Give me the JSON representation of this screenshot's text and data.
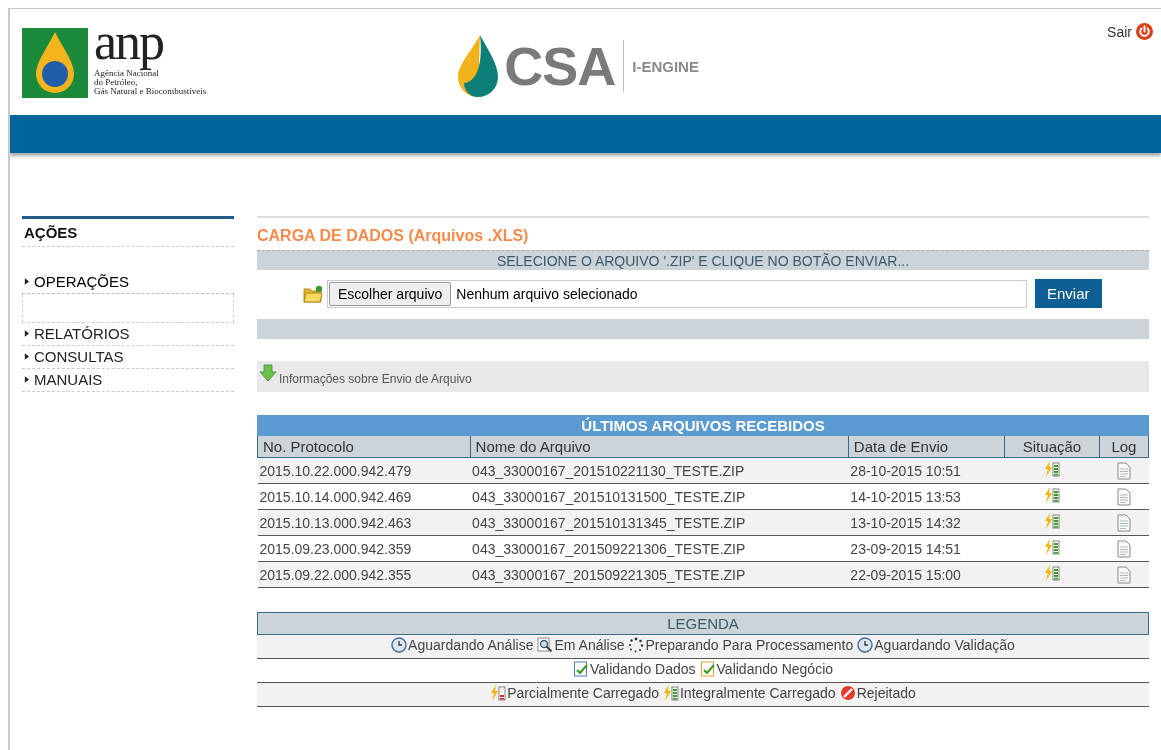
{
  "header": {
    "anp_logo": "anp",
    "anp_subtitle": [
      "Agência Nacional",
      "do Petróleo,",
      "Gás Natural e Biocombustíveis"
    ],
    "csa_logo": "CSA",
    "engine": "I-ENGINE",
    "logout": "Sair"
  },
  "sidebar": {
    "title": "AÇÕES",
    "items": [
      {
        "label": "OPERAÇÕES",
        "expanded": true
      },
      {
        "label": "RELATÓRIOS",
        "expanded": false
      },
      {
        "label": "CONSULTAS",
        "expanded": false
      },
      {
        "label": "MANUAIS",
        "expanded": false
      }
    ]
  },
  "upload": {
    "title": "CARGA DE DADOS (Arquivos .XLS)",
    "instruction": "SELECIONE O ARQUIVO '.ZIP' E CLIQUE NO BOTÃO ENVIAR...",
    "choose_button": "Escolher arquivo",
    "file_status": "Nenhum arquivo selecionado",
    "send_button": "Enviar",
    "info_link": "Informações sobre Envio de Arquivo"
  },
  "table": {
    "title": "ÚLTIMOS ARQUIVOS RECEBIDOS",
    "columns": [
      "No. Protocolo",
      "Nome do Arquivo",
      "Data de Envio",
      "Situação",
      "Log"
    ],
    "rows": [
      {
        "protocol": "2015.10.22.000.942.479",
        "file": "043_33000167_201510221130_TESTE.ZIP",
        "date": "28-10-2015 10:51",
        "kind": "integral"
      },
      {
        "protocol": "2015.10.14.000.942.469",
        "file": "043_33000167_201510131500_TESTE.ZIP",
        "date": "14-10-2015 13:53",
        "kind": "integral"
      },
      {
        "protocol": "2015.10.13.000.942.463",
        "file": "043_33000167_201510131345_TESTE.ZIP",
        "date": "13-10-2015 14:32",
        "kind": "integral"
      },
      {
        "protocol": "2015.09.23.000.942.359",
        "file": "043_33000167_201509221306_TESTE.ZIP",
        "date": "23-09-2015 14:51",
        "kind": "integral"
      },
      {
        "protocol": "2015.09.22.000.942.355",
        "file": "043_33000167_201509221305_TESTE.ZIP",
        "date": "22-09-2015 15:00",
        "kind": "integral"
      }
    ]
  },
  "legend": {
    "title": "LEGENDA",
    "lines": [
      {
        "entries": [
          {
            "kind": "clock",
            "label": "Aguardando Análise"
          },
          {
            "kind": "magnifier",
            "label": "Em Análise"
          },
          {
            "kind": "spinner",
            "label": "Preparando Para Processamento"
          },
          {
            "kind": "clock",
            "label": "Aguardando Validação"
          }
        ]
      },
      {
        "entries": [
          {
            "kind": "data-check",
            "label": "Validando Dados"
          },
          {
            "kind": "business-check",
            "label": "Validando Negócio"
          }
        ]
      },
      {
        "entries": [
          {
            "kind": "partial",
            "label": "Parcialmente Carregado"
          },
          {
            "kind": "integral",
            "label": "Integralmente Carregado"
          },
          {
            "kind": "rejected",
            "label": "Rejeitado"
          }
        ]
      }
    ]
  }
}
